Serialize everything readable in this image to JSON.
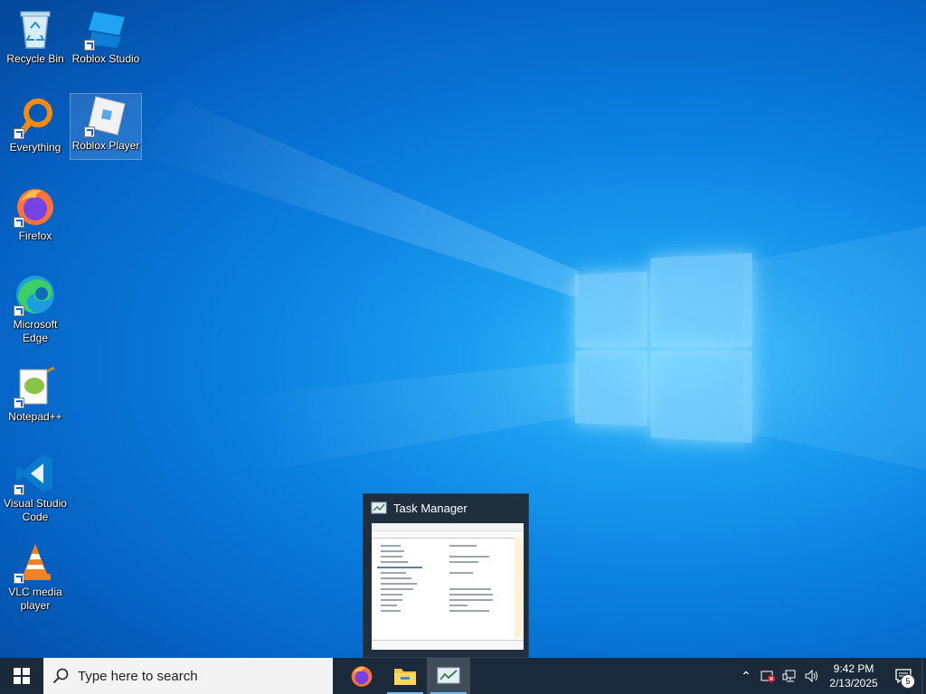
{
  "desktop": {
    "icons": [
      {
        "label": "Recycle Bin",
        "icon": "recycle-bin-icon"
      },
      {
        "label": "Roblox Studio",
        "icon": "roblox-studio-icon"
      },
      {
        "label": "Everything",
        "icon": "everything-search-icon"
      },
      {
        "label": "Roblox Player",
        "icon": "roblox-player-icon"
      },
      {
        "label": "Firefox",
        "icon": "firefox-icon"
      },
      {
        "label": "Microsoft Edge",
        "icon": "edge-icon"
      },
      {
        "label": "Notepad++",
        "icon": "notepad-plus-plus-icon"
      },
      {
        "label": "Visual Studio Code",
        "icon": "vscode-icon"
      },
      {
        "label": "VLC media player",
        "icon": "vlc-icon"
      }
    ]
  },
  "taskbar": {
    "search_placeholder": "Type here to search",
    "pinned_apps": [
      {
        "name": "Firefox",
        "icon": "firefox-icon"
      },
      {
        "name": "File Explorer",
        "icon": "folder-icon"
      },
      {
        "name": "Task Manager",
        "icon": "task-manager-icon",
        "active": true
      }
    ],
    "clock": {
      "time": "9:42 PM",
      "date": "2/13/2025"
    },
    "notification_count": "5"
  },
  "thumbnail": {
    "title": "Task Manager"
  },
  "colors": {
    "taskbar_bg": "#1b2a3a",
    "accent": "#76b9ed",
    "desktop_blue": "#0a7fe0"
  }
}
